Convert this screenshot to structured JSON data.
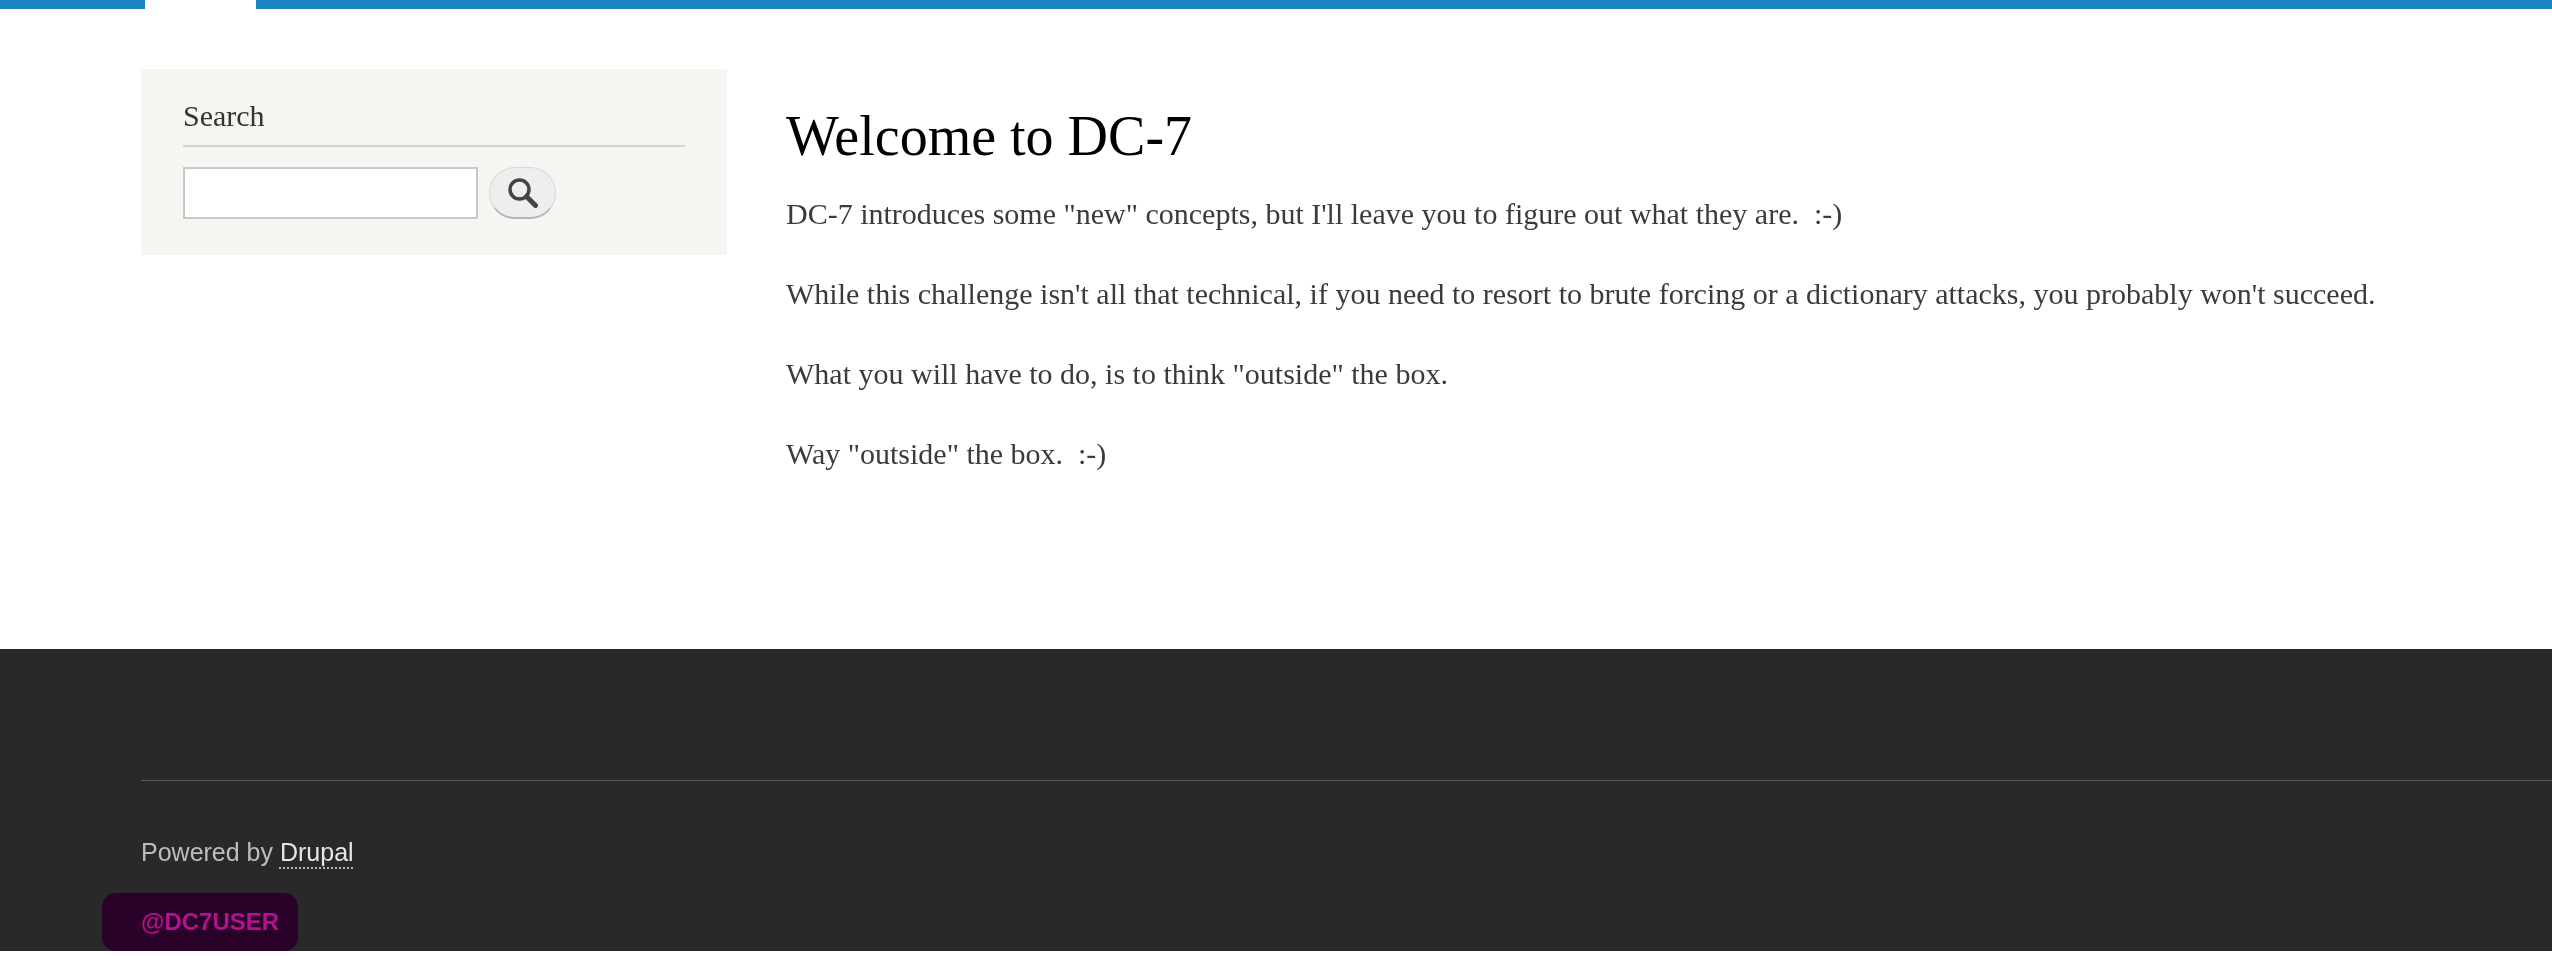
{
  "sidebar": {
    "search_block": {
      "title": "Search"
    }
  },
  "content": {
    "title": "Welcome to DC-7",
    "paragraphs": [
      "DC-7 introduces some \"new\" concepts, but I'll leave you to figure out what they are.  :-)",
      "While this challenge isn't all that technical, if you need to resort to brute forcing or a dictionary attacks, you probably won't succeed.",
      "What you will have to do, is to think \"outside\" the box.",
      "Way \"outside\" the box.  :-)"
    ]
  },
  "footer": {
    "credit": {
      "text": "Powered by",
      "link": "Drupal"
    },
    "handle": "@DC7USER"
  }
}
